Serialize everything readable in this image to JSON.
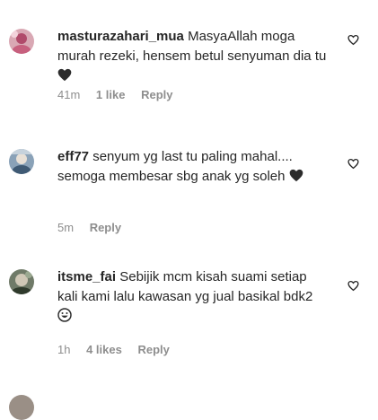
{
  "comments": [
    {
      "username": "masturazahari_mua",
      "text": "MasyaAllah moga murah rezeki, hensem betul senyuman dia tu",
      "emoji": "black-heart",
      "time": "41m",
      "likes": "1 like",
      "reply": "Reply"
    },
    {
      "username": "eff77",
      "text": "senyum yg last tu paling mahal.... semoga membesar sbg anak yg soleh",
      "emoji": "black-heart",
      "time": "5m",
      "likes": "",
      "reply": "Reply"
    },
    {
      "username": "itsme_fai",
      "text": "Sebijik mcm kisah suami setiap kali kami lalu kawasan yg jual basikal bdk2",
      "emoji": "grinning-face",
      "time": "1h",
      "likes": "4 likes",
      "reply": "Reply"
    }
  ],
  "icons": {
    "like": "heart-outline-icon"
  }
}
